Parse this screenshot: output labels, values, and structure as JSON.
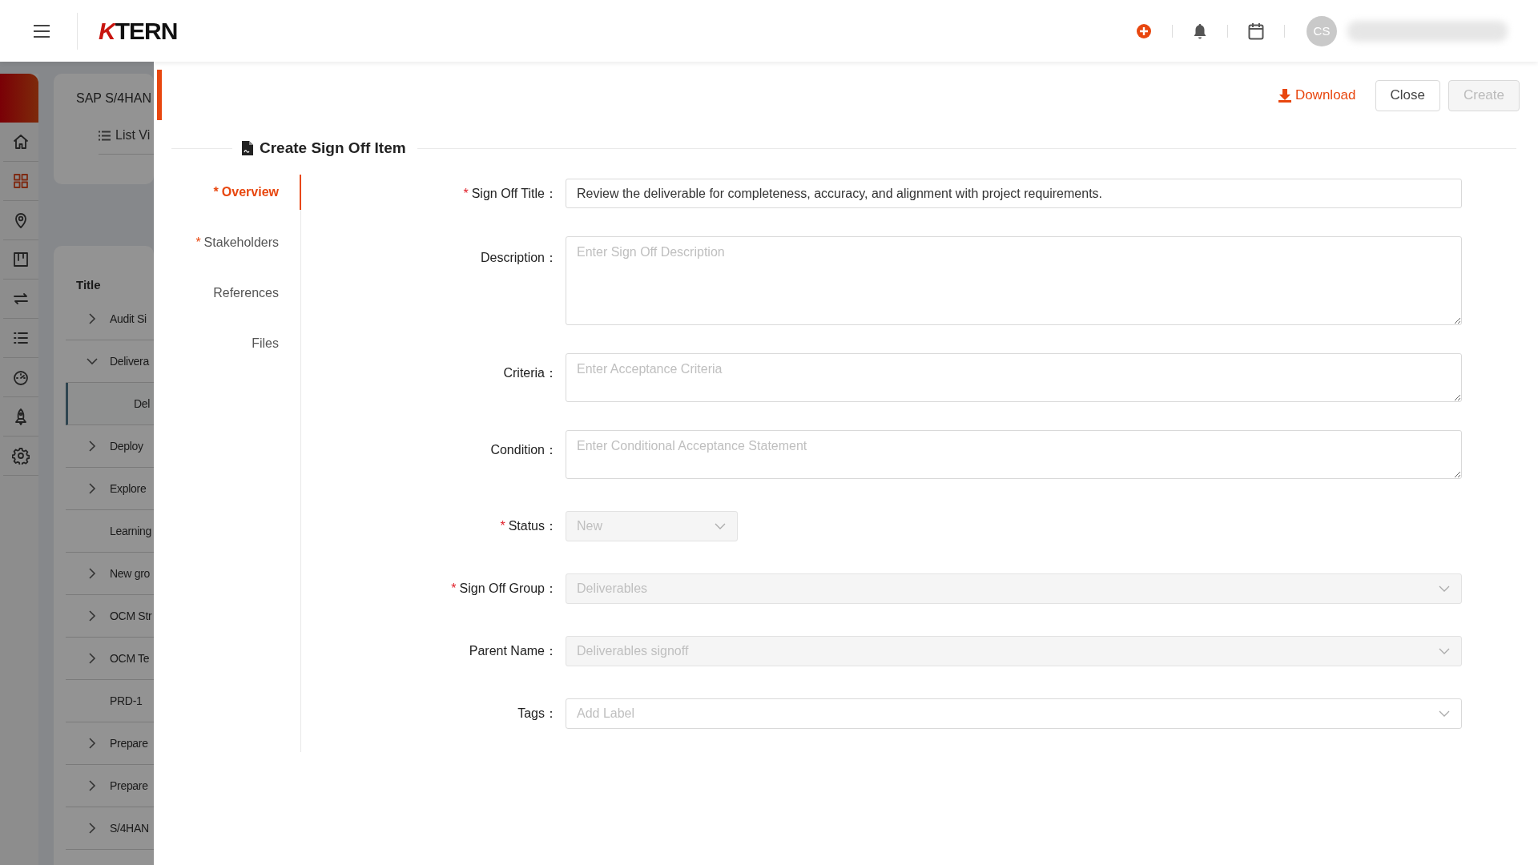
{
  "topbar": {
    "logo": {
      "accent": "K",
      "rest": "TERN"
    },
    "avatar": "CS"
  },
  "sidebar": {
    "items": [
      {
        "selected": false
      },
      {
        "selected": true
      },
      {
        "selected": false
      },
      {
        "selected": false
      },
      {
        "selected": false
      },
      {
        "selected": false
      },
      {
        "selected": false
      },
      {
        "selected": false
      },
      {
        "selected": false
      }
    ]
  },
  "project_card": {
    "title": "SAP S/4HAN",
    "view": "List Vi"
  },
  "tree": {
    "heading": "Title",
    "rows": [
      {
        "label": "Audit Si",
        "expandable": true,
        "expanded": false,
        "selected": false
      },
      {
        "label": "Delivera",
        "expandable": true,
        "expanded": true,
        "selected": false,
        "children": [
          {
            "label": "Del",
            "expandable": false,
            "selected": true
          }
        ]
      },
      {
        "label": "Deploy",
        "expandable": true,
        "expanded": false,
        "selected": false
      },
      {
        "label": "Explore",
        "expandable": true,
        "expanded": false,
        "selected": false
      },
      {
        "label": "Learning",
        "expandable": false,
        "selected": false
      },
      {
        "label": "New gro",
        "expandable": true,
        "expanded": false,
        "selected": false
      },
      {
        "label": "OCM Str",
        "expandable": true,
        "expanded": false,
        "selected": false
      },
      {
        "label": "OCM Te",
        "expandable": true,
        "expanded": false,
        "selected": false
      },
      {
        "label": "PRD-1",
        "expandable": false,
        "selected": false
      },
      {
        "label": "Prepare",
        "expandable": true,
        "expanded": false,
        "selected": false
      },
      {
        "label": "Prepare",
        "expandable": true,
        "expanded": false,
        "selected": false
      },
      {
        "label": "S/4HAN",
        "expandable": true,
        "expanded": false,
        "selected": false
      }
    ]
  },
  "drawer": {
    "actions": [
      {
        "kind": "link",
        "label": "Download",
        "disabled": false
      },
      {
        "kind": "button",
        "label": "Close",
        "disabled": false
      },
      {
        "kind": "button",
        "label": "Create",
        "disabled": true
      }
    ],
    "title": "Create Sign Off Item",
    "tabs": [
      {
        "label": "Overview",
        "required_mark": "*",
        "selected": true
      },
      {
        "label": "Stakeholders",
        "required_mark": "*",
        "selected": false
      },
      {
        "label": "References",
        "selected": false
      },
      {
        "label": "Files",
        "selected": false
      }
    ],
    "fields": [
      {
        "kind": "text",
        "label": "Sign Off Title：",
        "required_mark": "*",
        "value": "Review the deliverable for completeness, accuracy, and alignment with project requirements.",
        "disabled": false
      },
      {
        "kind": "long-textarea",
        "label": "Description：",
        "placeholder": "Enter Sign Off Description",
        "disabled": false
      },
      {
        "kind": "textarea",
        "label": "Criteria：",
        "placeholder": "Enter Acceptance Criteria",
        "disabled": false
      },
      {
        "kind": "textarea",
        "label": "Condition：",
        "placeholder": "Enter Conditional Acceptance Statement",
        "disabled": false
      },
      {
        "kind": "short-select",
        "label": "Status：",
        "required_mark": "*",
        "value": "New",
        "disabled": true
      },
      {
        "kind": "select",
        "label": "Sign Off Group：",
        "required_mark": "*",
        "value": "Deliverables",
        "disabled": true
      },
      {
        "kind": "select",
        "label": "Parent Name：",
        "value": "Deliverables signoff",
        "disabled": true
      },
      {
        "kind": "select",
        "label": "Tags：",
        "placeholder": "Add Label",
        "disabled": false
      }
    ]
  }
}
